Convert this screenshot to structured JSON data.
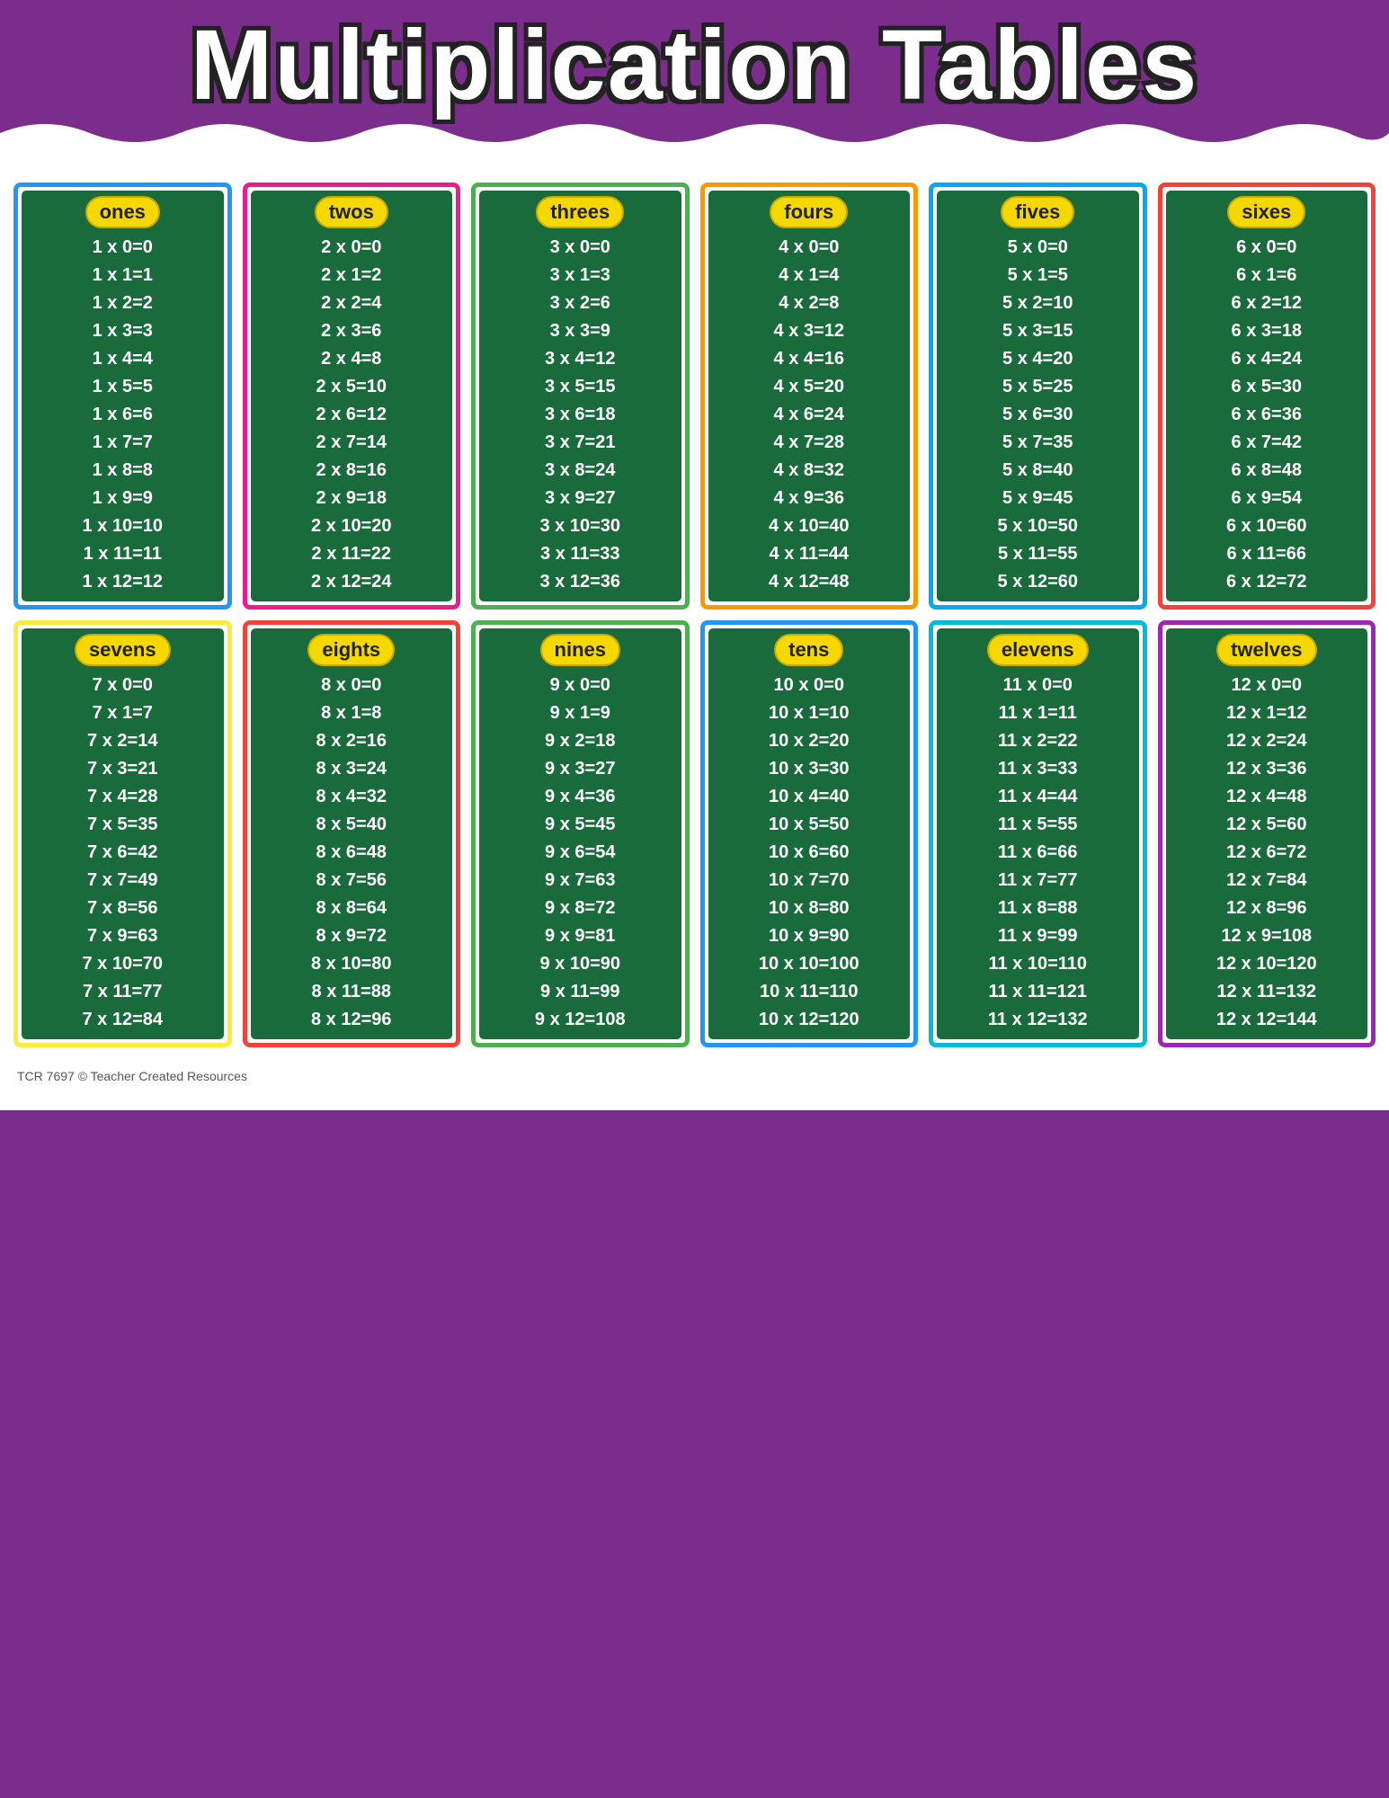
{
  "title": "Multiplication Tables",
  "footer": "TCR 7697 © Teacher Created Resources",
  "tables": [
    {
      "name": "ones",
      "border": "border-blue",
      "rows": [
        "1x0=0",
        "1x1=1",
        "1x2=2",
        "1x3=3",
        "1x4=4",
        "1x5=5",
        "1x6=6",
        "1x7=7",
        "1x8=8",
        "1x9=9",
        "1x10=10",
        "1x11=11",
        "1x12=12"
      ]
    },
    {
      "name": "twos",
      "border": "border-pink",
      "rows": [
        "2x0=0",
        "2x1=2",
        "2x2=4",
        "2x3=6",
        "2x4=8",
        "2x5=10",
        "2x6=12",
        "2x7=14",
        "2x8=16",
        "2x9=18",
        "2x10=20",
        "2x11=22",
        "2x12=24"
      ]
    },
    {
      "name": "threes",
      "border": "border-green",
      "rows": [
        "3x0=0",
        "3x1=3",
        "3x2=6",
        "3x3=9",
        "3x4=12",
        "3x5=15",
        "3x6=18",
        "3x7=21",
        "3x8=24",
        "3x9=27",
        "3x10=30",
        "3x11=33",
        "3x12=36"
      ]
    },
    {
      "name": "fours",
      "border": "border-orange",
      "rows": [
        "4x0=0",
        "4x1=4",
        "4x2=8",
        "4x3=12",
        "4x4=16",
        "4x5=20",
        "4x6=24",
        "4x7=28",
        "4x8=32",
        "4x9=36",
        "4x10=40",
        "4x11=44",
        "4x12=48"
      ]
    },
    {
      "name": "fives",
      "border": "border-blue2",
      "rows": [
        "5x0=0",
        "5x1=5",
        "5x2=10",
        "5x3=15",
        "5x4=20",
        "5x5=25",
        "5x6=30",
        "5x7=35",
        "5x8=40",
        "5x9=45",
        "5x10=50",
        "5x11=55",
        "5x12=60"
      ]
    },
    {
      "name": "sixes",
      "border": "border-red",
      "rows": [
        "6x0=0",
        "6x1=6",
        "6x2=12",
        "6x3=18",
        "6x4=24",
        "6x5=30",
        "6x6=36",
        "6x7=42",
        "6x8=48",
        "6x9=54",
        "6x10=60",
        "6x11=66",
        "6x12=72"
      ]
    },
    {
      "name": "sevens",
      "border": "border-yellow",
      "rows": [
        "7x0=0",
        "7x1=7",
        "7x2=14",
        "7x3=21",
        "7x4=28",
        "7x5=35",
        "7x6=42",
        "7x7=49",
        "7x8=56",
        "7x9=63",
        "7x10=70",
        "7x11=77",
        "7x12=84"
      ]
    },
    {
      "name": "eights",
      "border": "border-red",
      "rows": [
        "8x0=0",
        "8x1=8",
        "8x2=16",
        "8x3=24",
        "8x4=32",
        "8x5=40",
        "8x6=48",
        "8x7=56",
        "8x8=64",
        "8x9=72",
        "8x10=80",
        "8x11=88",
        "8x12=96"
      ]
    },
    {
      "name": "nines",
      "border": "border-green",
      "rows": [
        "9x0=0",
        "9x1=9",
        "9x2=18",
        "9x3=27",
        "9x4=36",
        "9x5=45",
        "9x6=54",
        "9x7=63",
        "9x8=72",
        "9x9=81",
        "9x10=90",
        "9x11=99",
        "9x12=108"
      ]
    },
    {
      "name": "tens",
      "border": "border-blue",
      "rows": [
        "10x0=0",
        "10x1=10",
        "10x2=20",
        "10x3=30",
        "10x4=40",
        "10x5=50",
        "10x6=60",
        "10x7=70",
        "10x8=80",
        "10x9=90",
        "10x10=100",
        "10x11=110",
        "10x12=120"
      ]
    },
    {
      "name": "elevens",
      "border": "border-cyan",
      "rows": [
        "11x0=0",
        "11x1=11",
        "11x2=22",
        "11x3=33",
        "11x4=44",
        "11x5=55",
        "11x6=66",
        "11x7=77",
        "11x8=88",
        "11x9=99",
        "11x10=110",
        "11x11=121",
        "11x12=132"
      ]
    },
    {
      "name": "twelves",
      "border": "border-purple",
      "rows": [
        "12x0=0",
        "12x1=12",
        "12x2=24",
        "12x3=36",
        "12x4=48",
        "12x5=60",
        "12x6=72",
        "12x7=84",
        "12x8=96",
        "12x9=108",
        "12x10=120",
        "12x11=132",
        "12x12=144"
      ]
    }
  ]
}
